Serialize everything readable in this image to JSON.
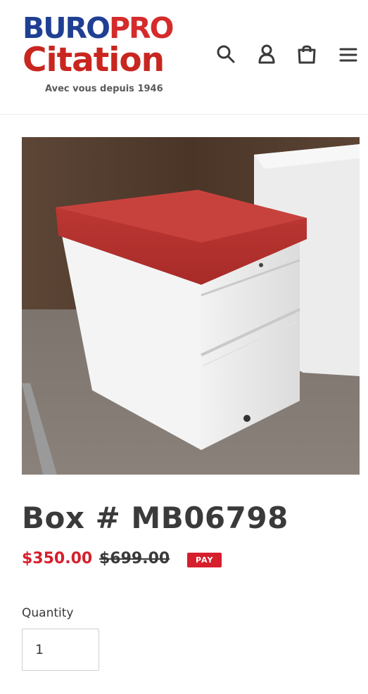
{
  "brand": {
    "logo_word1": "BURO",
    "logo_word2": "PRO",
    "logo_word3": "Citation",
    "tagline": "Avec vous depuis 1946",
    "colors": {
      "blue": "#1f3f93",
      "red": "#d52b2b"
    }
  },
  "header": {
    "icons": [
      "search-icon",
      "account-icon",
      "cart-icon",
      "menu-icon"
    ]
  },
  "product": {
    "image_alt": "Box # MB06798",
    "title": "Box # MB06798",
    "sale_price": "$350.00",
    "regular_price": "$699.00",
    "badge": "PAY",
    "quantity_label": "Quantity",
    "quantity_value": "1"
  },
  "colors": {
    "sale": "#d61f2c",
    "text": "#3a3a3a"
  }
}
